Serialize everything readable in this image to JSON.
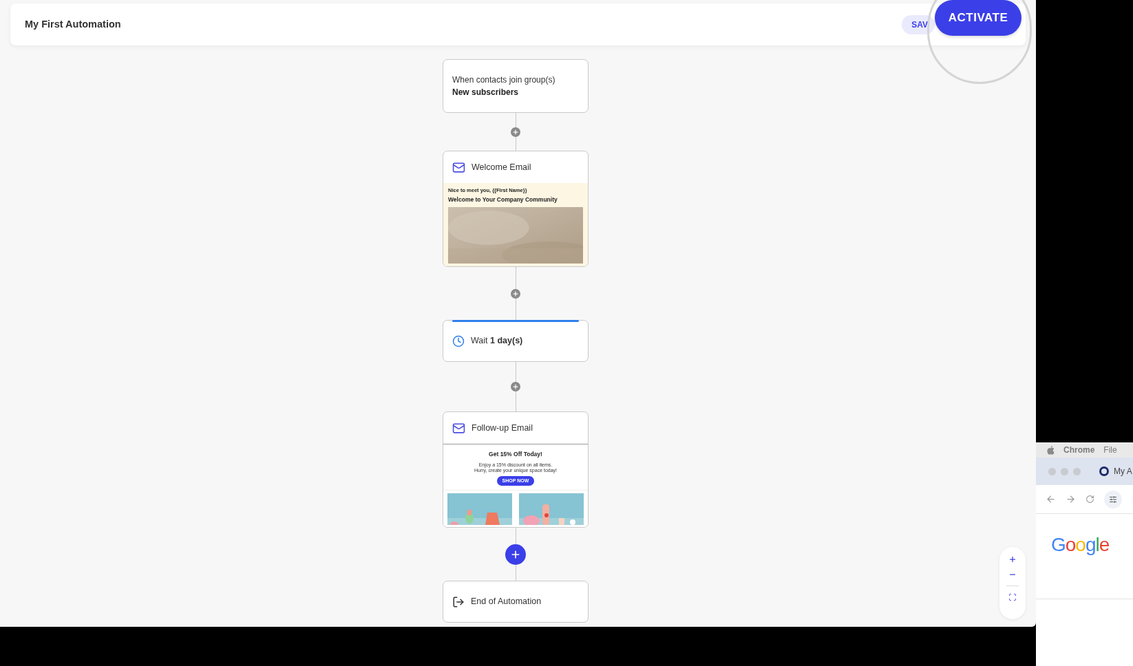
{
  "header": {
    "title": "My First Automation",
    "save_button": "SAV",
    "activate_button": "ACTIVATE"
  },
  "steps": [
    {
      "kind": "trigger",
      "line1": "When contacts join group(s)",
      "line2": "New subscribers"
    },
    {
      "kind": "email",
      "title": "Welcome Email",
      "preview": {
        "kind": "welcome",
        "greeting": "Nice to meet you, {{First Name}}",
        "headline": "Welcome to Your Company Community"
      }
    },
    {
      "kind": "wait",
      "label": "Wait",
      "value": "1 day(s)",
      "selected": true
    },
    {
      "kind": "email",
      "title": "Follow-up Email",
      "preview": {
        "kind": "promo",
        "headline": "Get 15% Off Today!",
        "body": [
          "Enjoy a 15% discount on all items.",
          "Hurry, create your unique space today!"
        ],
        "button": "SHOP NOW"
      }
    },
    {
      "kind": "end",
      "label": "End of Automation"
    }
  ],
  "connectors": [
    {
      "kind": "small"
    },
    {
      "kind": "small"
    },
    {
      "kind": "small"
    },
    {
      "kind": "primary"
    }
  ],
  "browser": {
    "menu": [
      "Chrome",
      "File"
    ],
    "tab": "My A",
    "logo": "Google"
  }
}
